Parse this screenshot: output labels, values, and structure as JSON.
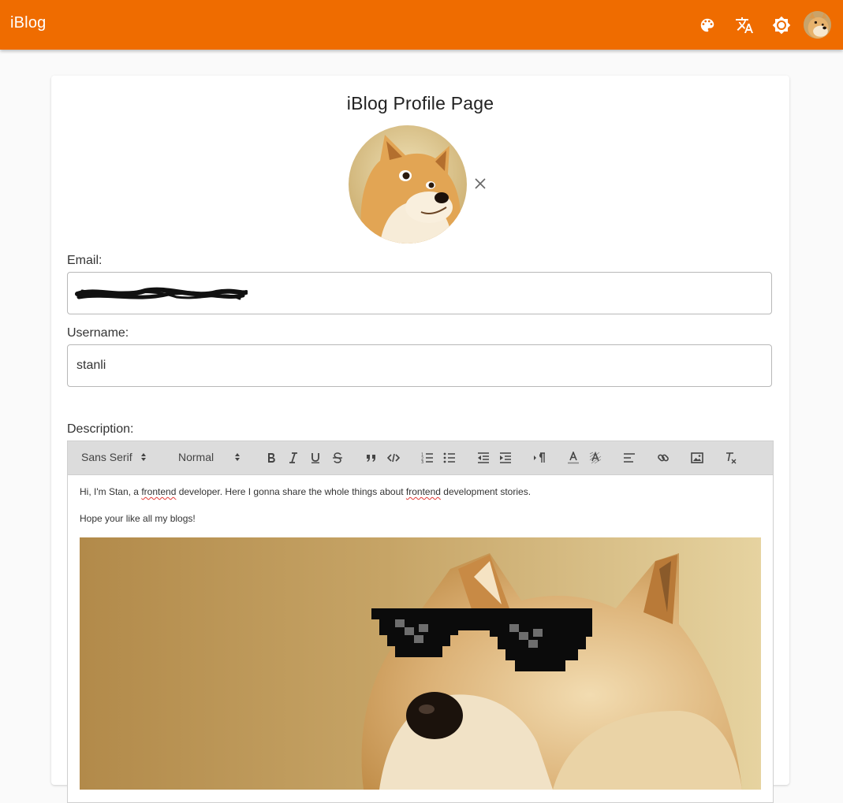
{
  "appbar": {
    "brand": "iBlog",
    "color": "#ef6c00",
    "actions": [
      {
        "name": "palette-icon"
      },
      {
        "name": "translate-icon"
      },
      {
        "name": "brightness-icon"
      },
      {
        "name": "user-avatar"
      }
    ]
  },
  "profile": {
    "title": "iBlog Profile Page",
    "avatar_remove_icon": "close-icon",
    "email": {
      "label": "Email:",
      "value": ""
    },
    "username": {
      "label": "Username:",
      "value": "stanli"
    },
    "description": {
      "label": "Description:",
      "toolbar": {
        "font": "Sans Serif",
        "size": "Normal",
        "buttons": [
          "bold-icon",
          "italic-icon",
          "underline-icon",
          "strike-icon",
          "blockquote-icon",
          "code-icon",
          "ordered-list-icon",
          "bullet-list-icon",
          "outdent-icon",
          "indent-icon",
          "rtl-icon",
          "text-color-icon",
          "background-color-icon",
          "align-icon",
          "link-icon",
          "image-icon",
          "clear-format-icon"
        ]
      },
      "paragraphs": [
        {
          "before": "Hi, I'm Stan, a ",
          "word1": "frontend",
          "middle": " developer. Here I gonna share the whole things about ",
          "word2": "frontend",
          "after": " development stories."
        },
        {
          "text": "Hope your like all my blogs!"
        }
      ],
      "image_name": "doge-sunglasses-image"
    }
  }
}
